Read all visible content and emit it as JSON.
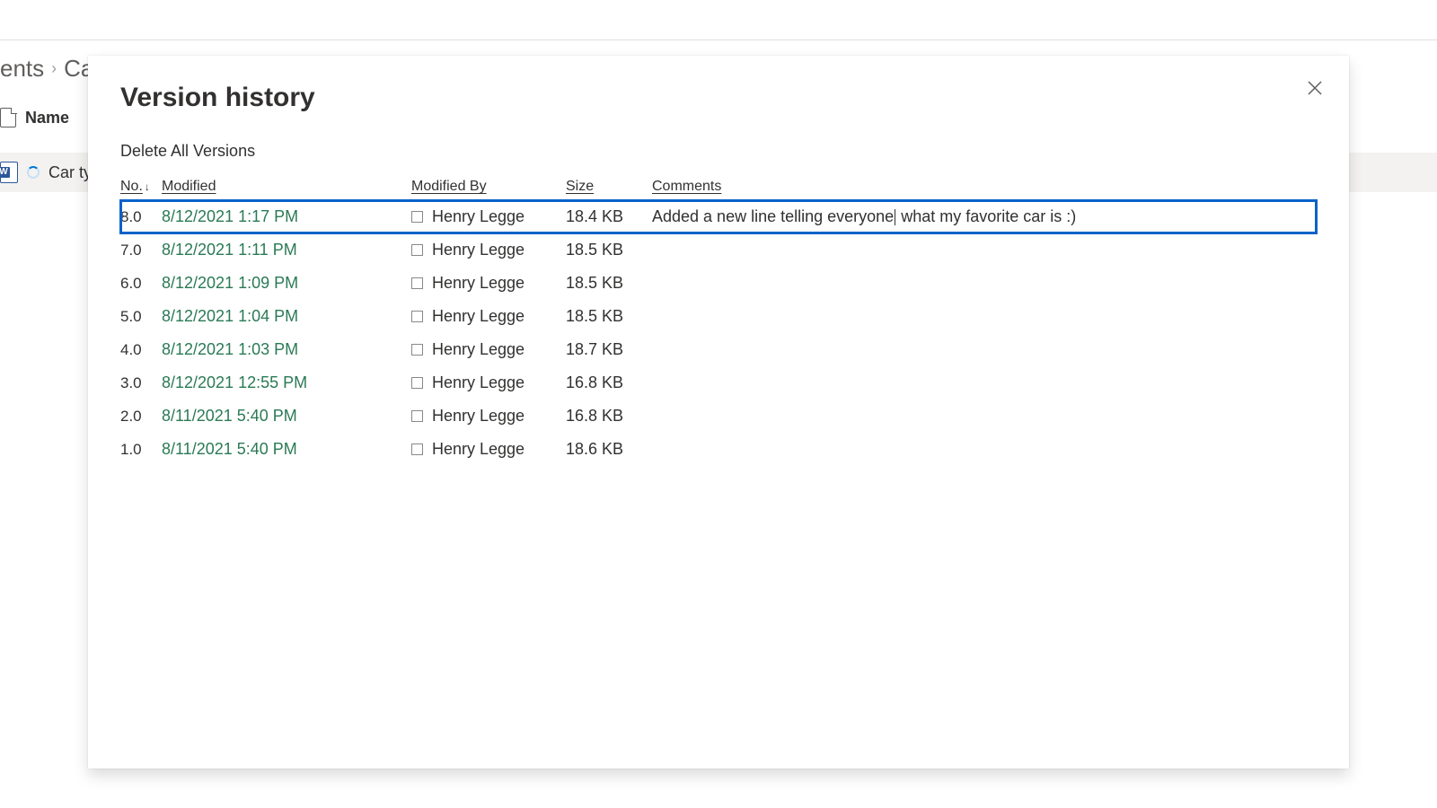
{
  "breadcrumb": {
    "parent_fragment": "ents",
    "current_fragment": "Ca"
  },
  "bg": {
    "name_col": "Name",
    "file_fragment": "Car typ"
  },
  "dialog": {
    "title": "Version history",
    "delete_all": "Delete All Versions",
    "headers": {
      "no": "No.",
      "modified": "Modified",
      "modified_by": "Modified By",
      "size": "Size",
      "comments": "Comments"
    }
  },
  "versions": [
    {
      "no": "8.0",
      "modified": "8/12/2021 1:17 PM",
      "by": "Henry Legge",
      "size": "18.4 KB",
      "comments_a": "Added a new line telling everyone",
      "comments_b": "what my favorite car is :)",
      "highlight": true
    },
    {
      "no": "7.0",
      "modified": "8/12/2021 1:11 PM",
      "by": "Henry Legge",
      "size": "18.5 KB",
      "comments_a": "",
      "comments_b": ""
    },
    {
      "no": "6.0",
      "modified": "8/12/2021 1:09 PM",
      "by": "Henry Legge",
      "size": "18.5 KB",
      "comments_a": "",
      "comments_b": ""
    },
    {
      "no": "5.0",
      "modified": "8/12/2021 1:04 PM",
      "by": "Henry Legge",
      "size": "18.5 KB",
      "comments_a": "",
      "comments_b": ""
    },
    {
      "no": "4.0",
      "modified": "8/12/2021 1:03 PM",
      "by": "Henry Legge",
      "size": "18.7 KB",
      "comments_a": "",
      "comments_b": ""
    },
    {
      "no": "3.0",
      "modified": "8/12/2021 12:55 PM",
      "by": "Henry Legge",
      "size": "16.8 KB",
      "comments_a": "",
      "comments_b": ""
    },
    {
      "no": "2.0",
      "modified": "8/11/2021 5:40 PM",
      "by": "Henry Legge",
      "size": "16.8 KB",
      "comments_a": "",
      "comments_b": ""
    },
    {
      "no": "1.0",
      "modified": "8/11/2021 5:40 PM",
      "by": "Henry Legge",
      "size": "18.6 KB",
      "comments_a": "",
      "comments_b": ""
    }
  ]
}
